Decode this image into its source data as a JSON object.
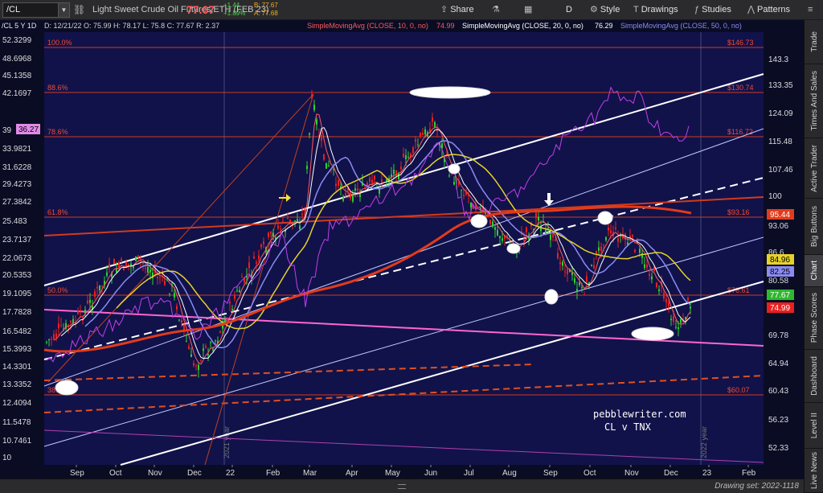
{
  "toolbar": {
    "symbol": "/CL",
    "instrument": "Light Sweet Crude Oil Futures,ETH (FEB 23)",
    "last": "77.67",
    "change": "+1.44",
    "change_pct": "+1.89%",
    "bid": "B: 77.67",
    "ask": "A: 77.68",
    "share": "Share",
    "period": "D",
    "style": "Style",
    "drawings": "Drawings",
    "studies": "Studies",
    "patterns": "Patterns"
  },
  "header": {
    "symbol_period": "/CL 5 Y 1D",
    "ohlc": "D: 12/21/22  O: 75.99  H: 78.17  L: 75.8  C: 77.67  R: 2.37",
    "sma10_label": "SimpleMovingAvg (CLOSE, 10, 0, no)",
    "sma10_value": "74.99",
    "sma20_label": "SimpleMovingAvg (CLOSE, 20, 0, no)",
    "sma20_value": "76.29",
    "sma50_label": "SimpleMovingAvg (CLOSE, 50, 0, no)"
  },
  "tabs": [
    "Trade",
    "Times And Sales",
    "Active Trader",
    "Big Buttons",
    "Chart",
    "Phase Scores",
    "Dashboard",
    "Level II",
    "Live News"
  ],
  "active_tab": "Chart",
  "left_axis": [
    "52.3299",
    "48.6968",
    "45.1358",
    "42.1697",
    "39",
    "33.9821",
    "31.6228",
    "29.4273",
    "27.3842",
    "25.483",
    "23.7137",
    "22.0673",
    "20.5353",
    "19.1095",
    "17.7828",
    "16.5482",
    "15.3993",
    "14.3301",
    "13.3352",
    "12.4094",
    "11.5478",
    "10.7461",
    "10"
  ],
  "left_axis_tag": "36.27",
  "right_axis": [
    "143.3",
    "133.35",
    "124.09",
    "115.48",
    "107.46",
    "100",
    "93.06",
    "86.6",
    "80.58",
    "69.78",
    "64.94",
    "60.43",
    "56.23",
    "52.33"
  ],
  "price_tags": [
    {
      "text": "95.44",
      "bg": "#e23b1b",
      "fg": "#ffffff"
    },
    {
      "text": "84.96",
      "bg": "#e6d22b",
      "fg": "#000000"
    },
    {
      "text": "82.25",
      "bg": "#8b8bf2",
      "fg": "#000000"
    },
    {
      "text": "77.67",
      "bg": "#2fb82f",
      "fg": "#ffffff"
    },
    {
      "text": "74.99",
      "bg": "#e82020",
      "fg": "#ffffff"
    }
  ],
  "fib_levels": [
    {
      "pct": "100.0%",
      "price": "$146.73"
    },
    {
      "pct": "88.6%",
      "price": "$130.74"
    },
    {
      "pct": "78.6%",
      "price": "$116.72"
    },
    {
      "pct": "61.8%",
      "price": "$93.16"
    },
    {
      "pct": "50.0%",
      "price": "$76.61"
    },
    {
      "pct": "38.2%",
      "price": "$60.07"
    }
  ],
  "x_axis": [
    "Sep",
    "Oct",
    "Nov",
    "Dec",
    "22",
    "Feb",
    "Mar",
    "Apr",
    "May",
    "Jun",
    "Jul",
    "Aug",
    "Sep",
    "Oct",
    "Nov",
    "Dec",
    "23",
    "Feb"
  ],
  "year_marks": [
    "2021 year",
    "2022 year"
  ],
  "watermark": [
    "pebblewriter.com",
    "CL v TNX"
  ],
  "status": "Drawing set: 2022-1118",
  "colors": {
    "sma10": "#ff5a5a",
    "sma20": "#ffffff",
    "sma50": "#8b8bf2",
    "accent": "#e23b1b"
  }
}
